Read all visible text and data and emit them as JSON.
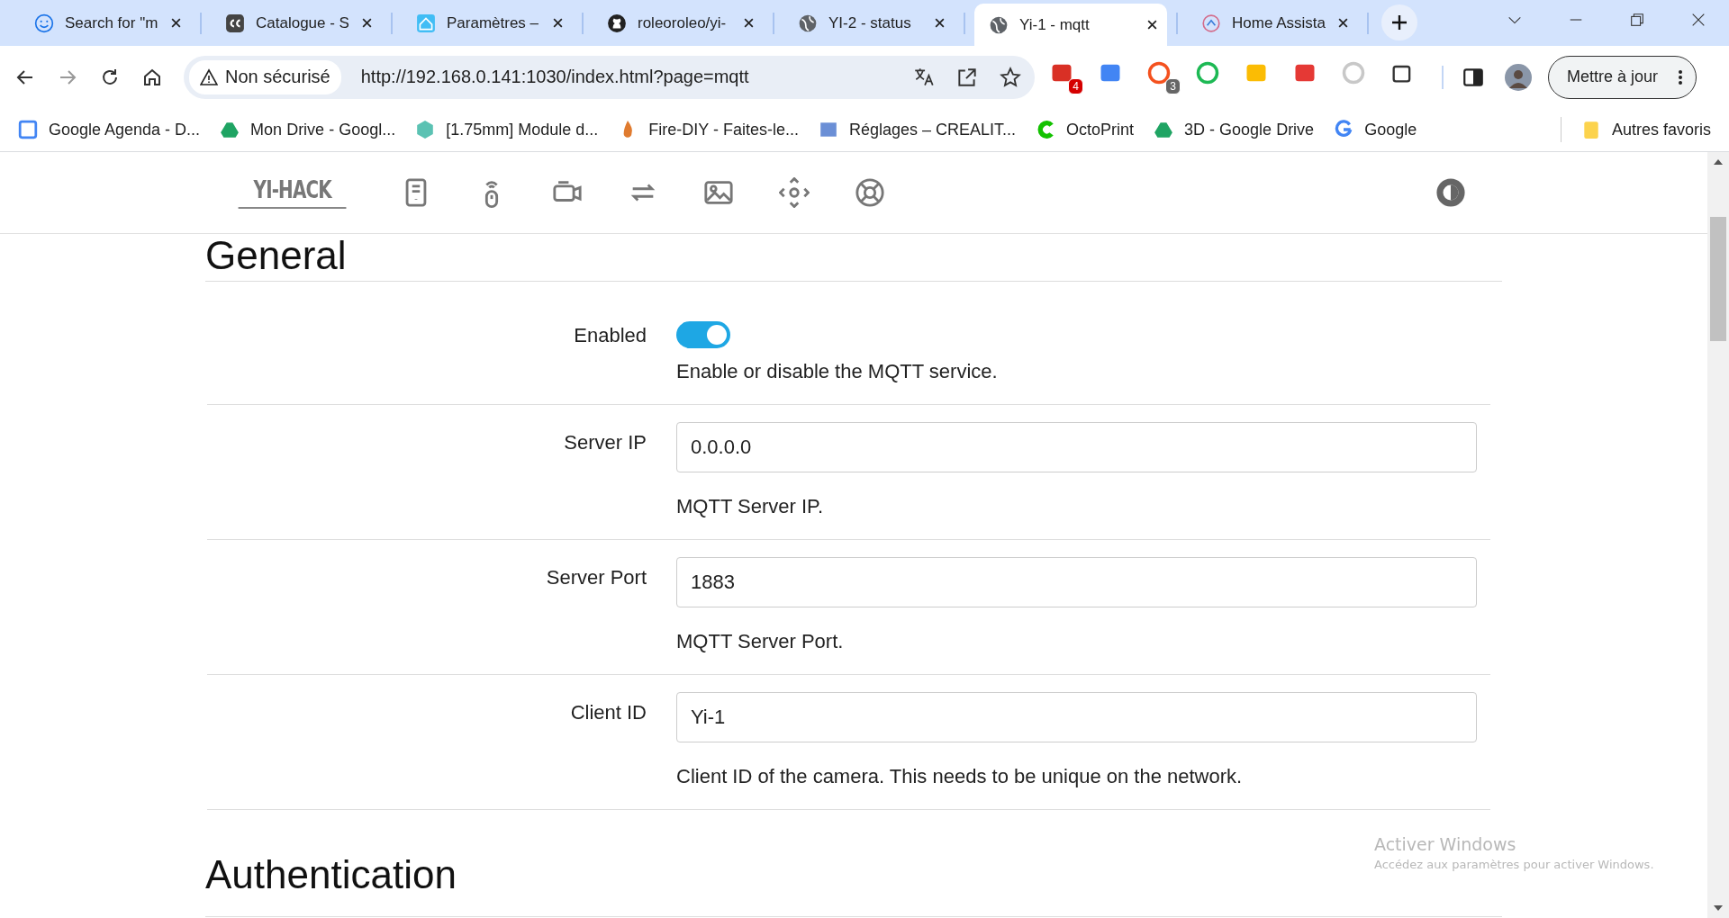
{
  "browser": {
    "tabs": [
      {
        "title": "Search for \"m",
        "kind": "smiley",
        "selected": false
      },
      {
        "title": "Catalogue - S",
        "kind": "cc",
        "selected": false
      },
      {
        "title": "Paramètres –",
        "kind": "house",
        "selected": false
      },
      {
        "title": "roleoroleo/yi-",
        "kind": "github",
        "selected": false
      },
      {
        "title": "YI-2 - status",
        "kind": "globe",
        "selected": false
      },
      {
        "title": "Yi-1 - mqtt",
        "kind": "globe",
        "selected": true
      },
      {
        "title": "Home Assista",
        "kind": "ring",
        "selected": false
      }
    ],
    "address": {
      "security": "Non sécurisé",
      "url": "http://192.168.0.141:1030/index.html?page=mqtt"
    },
    "extensions": [
      {
        "kind": "mail",
        "badge": "4"
      },
      {
        "kind": "translate"
      },
      {
        "kind": "diamond",
        "badge": "3"
      },
      {
        "kind": "pin"
      },
      {
        "kind": "bulb"
      },
      {
        "kind": "tp"
      },
      {
        "kind": "grey"
      },
      {
        "kind": "puzzle"
      }
    ],
    "update_button": "Mettre à jour",
    "bookmarks": [
      {
        "label": "Google Agenda - D...",
        "kind": "calendar"
      },
      {
        "label": "Mon Drive - Googl...",
        "kind": "drive"
      },
      {
        "label": "[1.75mm] Module d...",
        "kind": "hex"
      },
      {
        "label": "Fire-DIY - Faites-le...",
        "kind": "flame"
      },
      {
        "label": "Réglages – CREALIT...",
        "kind": "cube"
      },
      {
        "label": "OctoPrint",
        "kind": "octo"
      },
      {
        "label": "3D - Google Drive",
        "kind": "drive"
      },
      {
        "label": "Google",
        "kind": "google"
      }
    ],
    "other_bookmarks": "Autres favoris"
  },
  "app": {
    "logo": "YI-HACK",
    "sections": [
      {
        "title": "General",
        "fields": [
          {
            "kind": "toggle",
            "label": "Enabled",
            "on": true,
            "help": "Enable or disable the MQTT service."
          },
          {
            "kind": "text",
            "label": "Server IP",
            "value": "0.0.0.0",
            "help": "MQTT Server IP."
          },
          {
            "kind": "text",
            "label": "Server Port",
            "value": "1883",
            "help": "MQTT Server Port."
          },
          {
            "kind": "text",
            "label": "Client ID",
            "value": "Yi-1",
            "help": "Client ID of the camera. This needs to be unique on the network."
          }
        ]
      },
      {
        "title": "Authentication"
      }
    ]
  },
  "os_notice": {
    "title": "Activer Windows",
    "subtitle": "Accédez aux paramètres pour activer Windows."
  }
}
